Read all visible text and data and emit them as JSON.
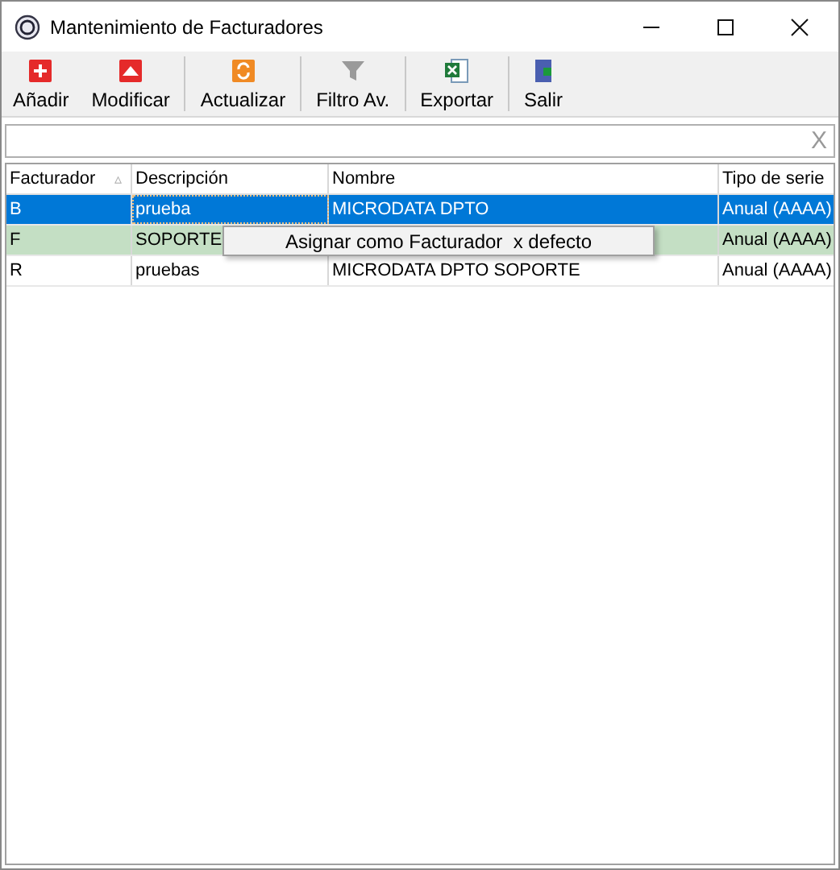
{
  "window": {
    "title": "Mantenimiento de Facturadores"
  },
  "toolbar": [
    {
      "label": "Añadir",
      "kind": "add"
    },
    {
      "label": "Modificar",
      "kind": "edit"
    },
    {
      "label": "Actualizar",
      "kind": "refresh"
    },
    {
      "label": "Filtro Av.",
      "kind": "filter"
    },
    {
      "label": "Exportar",
      "kind": "export"
    },
    {
      "label": "Salir",
      "kind": "exit"
    }
  ],
  "search": {
    "clear": "X"
  },
  "table": {
    "columns": [
      {
        "label": "Facturador",
        "sort": "▵"
      },
      {
        "label": "Descripción"
      },
      {
        "label": "Nombre"
      },
      {
        "label": "Tipo de serie"
      }
    ],
    "rows": [
      {
        "cells": [
          "B",
          "prueba",
          "MICRODATA DPTO",
          "Anual (AAAA)"
        ],
        "selected": true,
        "default": false
      },
      {
        "cells": [
          "F",
          "SOPORTE",
          "",
          "Anual (AAAA)"
        ],
        "selected": false,
        "default": true
      },
      {
        "cells": [
          "R",
          "pruebas",
          "MICRODATA DPTO SOPORTE",
          "Anual (AAAA)"
        ],
        "selected": false,
        "default": false
      }
    ]
  },
  "context_menu": {
    "items": [
      "Asignar como Facturador  x defecto"
    ]
  }
}
